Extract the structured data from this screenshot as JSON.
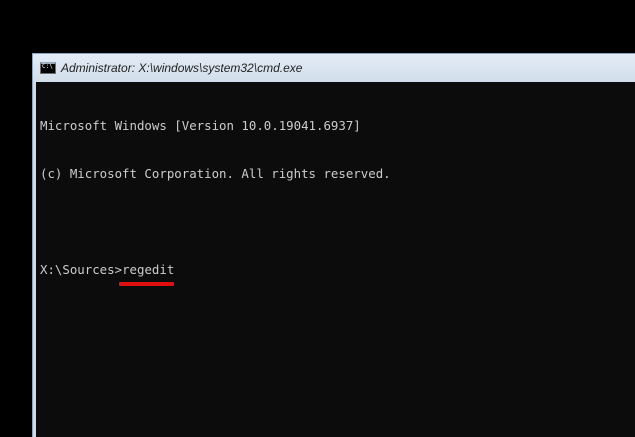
{
  "window": {
    "title": "Administrator: X:\\windows\\system32\\cmd.exe",
    "icon": "cmd-icon",
    "icon_label": "C:\\"
  },
  "console": {
    "lines": [
      "Microsoft Windows [Version 10.0.19041.6937]",
      "(c) Microsoft Corporation. All rights reserved.",
      ""
    ],
    "prompt": "X:\\Sources>",
    "command": "regedit"
  },
  "colors": {
    "highlight_underline": "#e01010",
    "console_background": "#0c0c0c",
    "console_text": "#cccccc"
  }
}
